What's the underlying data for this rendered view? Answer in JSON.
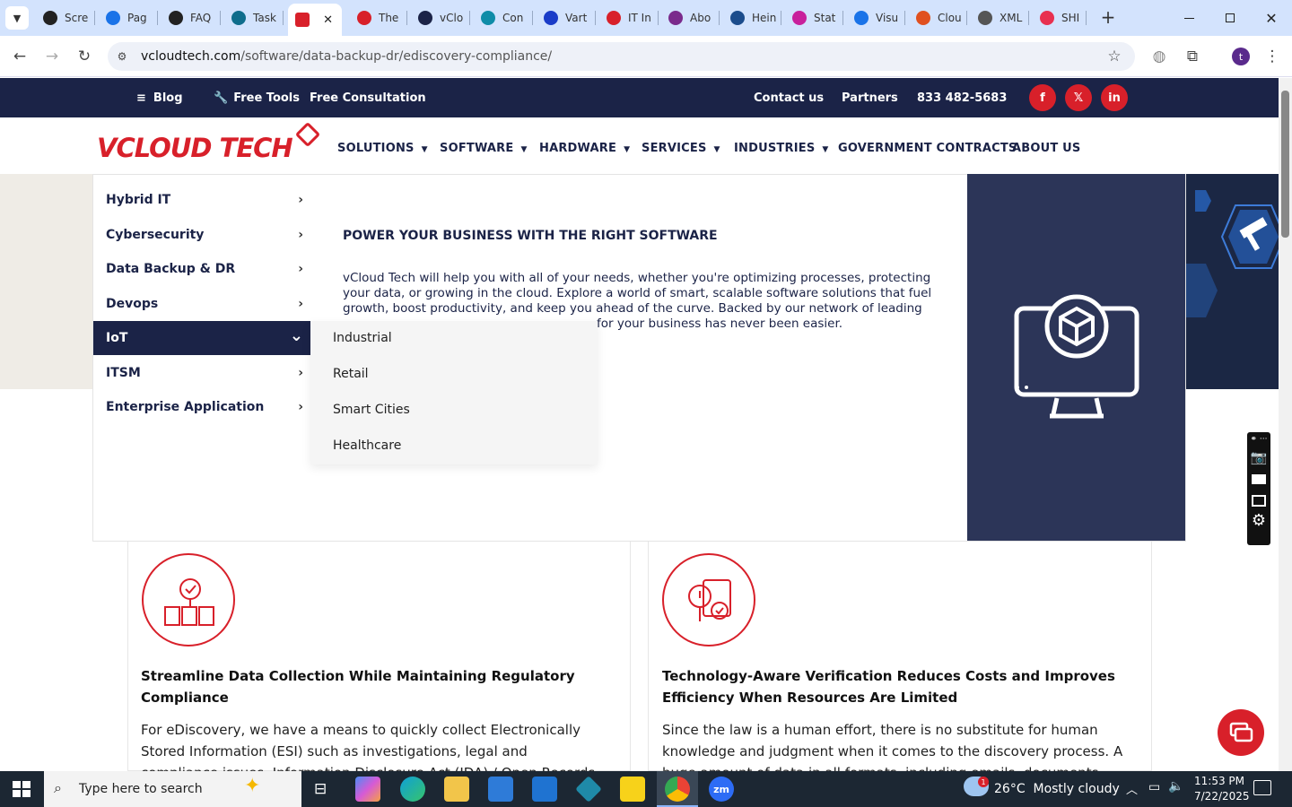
{
  "browser": {
    "tabs": [
      {
        "label": "Scre",
        "color": "#222"
      },
      {
        "label": "Pag",
        "color": "#1a73e8"
      },
      {
        "label": "FAQ",
        "color": "#222"
      },
      {
        "label": "Task",
        "color": "#0f6d8c"
      },
      {
        "label": "",
        "color": "#d8202a"
      },
      {
        "label": "The",
        "color": "#d8202a"
      },
      {
        "label": "vClo",
        "color": "#1b2347"
      },
      {
        "label": "Con",
        "color": "#0f8ca8"
      },
      {
        "label": "Vart",
        "color": "#1a3cc8"
      },
      {
        "label": "IT In",
        "color": "#d8202a"
      },
      {
        "label": "Abo",
        "color": "#7a2a8c"
      },
      {
        "label": "Hein",
        "color": "#1b4c8c"
      },
      {
        "label": "Stat",
        "color": "#c8209c"
      },
      {
        "label": "Visu",
        "color": "#1a73e8"
      },
      {
        "label": "Clou",
        "color": "#e05020"
      },
      {
        "label": "XML",
        "color": "#555"
      },
      {
        "label": "SHI",
        "color": "#e83050"
      }
    ],
    "active_close": "✕",
    "new_tab": "+",
    "url_host": "vcloudtech.com",
    "url_path": "/software/data-backup-dr/ediscovery-compliance/",
    "profile_initial": "t"
  },
  "topnav": {
    "blog": "Blog",
    "free_tools": "Free Tools",
    "free_consultation": "Free Consultation",
    "contact": "Contact us",
    "partners": "Partners",
    "phone": "833 482-5683",
    "social": [
      "f",
      "𝕏",
      "in"
    ]
  },
  "logo": {
    "text": "VCLOUD TECH"
  },
  "mainnav": [
    "SOLUTIONS",
    "SOFTWARE",
    "HARDWARE",
    "SERVICES",
    "INDUSTRIES",
    "GOVERNMENT CONTRACTS",
    "ABOUT US"
  ],
  "mega": {
    "sidebar": [
      "Hybrid IT",
      "Cybersecurity",
      "Data Backup & DR",
      "Devops",
      "IoT",
      "ITSM",
      "Enterprise Application"
    ],
    "submenu": [
      "Industrial",
      "Retail",
      "Smart Cities",
      "Healthcare"
    ],
    "heading": "POWER YOUR BUSINESS WITH THE RIGHT SOFTWARE",
    "para_lines": [
      "vCloud Tech will help you with all of your needs, whether you're optimizing processes, protecting",
      "your data, or growing in the cloud. Explore a world of smart, scalable software solutions that fuel",
      "growth, boost productivity, and keep you ahead of the curve. Backed by our network of leading",
      "for your business has never been easier."
    ]
  },
  "cards": [
    {
      "title_lines": [
        "Streamline Data Collection While Maintaining Regulatory",
        "Compliance"
      ],
      "text_lines": [
        "For eDiscovery, we have a means to quickly collect Electronically",
        "Stored Information (ESI) such as investigations, legal and",
        "compliance issues, Information Disclosure Act (IDA) / Open Records"
      ]
    },
    {
      "title_lines": [
        "Technology-Aware Verification Reduces Costs and Improves",
        "Efficiency When Resources Are Limited"
      ],
      "text_lines": [
        "Since the law is a human effort, there is no substitute for human",
        "knowledge and judgment when it comes to the discovery process. A",
        "huge amount of data in all formats, including emails, documents"
      ]
    }
  ],
  "taskbar": {
    "search_placeholder": "Type here to search",
    "weather": "26°C  Mostly cloudy",
    "time": "11:53 PM",
    "date": "7/22/2025",
    "weather_badge": "1"
  }
}
